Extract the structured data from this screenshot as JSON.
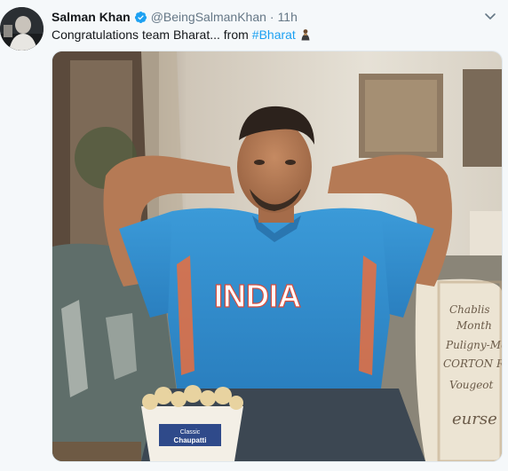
{
  "tweet": {
    "author_name": "Salman Khan",
    "handle": "@BeingSalmanKhan",
    "separator": "·",
    "time": "11h",
    "text": "Congratulations team Bharat... from",
    "hashtag": "#Bharat",
    "verified": true
  },
  "icons": {
    "verified": "verified-badge-icon",
    "caret": "chevron-down-icon",
    "emoji": "person-emoji-icon"
  },
  "media": {
    "jersey_text": "INDIA",
    "popcorn_label": "Classic\nChaupatti"
  },
  "colors": {
    "link": "#1da1f2",
    "secondary": "#657786",
    "jersey": "#2f8fd0"
  }
}
